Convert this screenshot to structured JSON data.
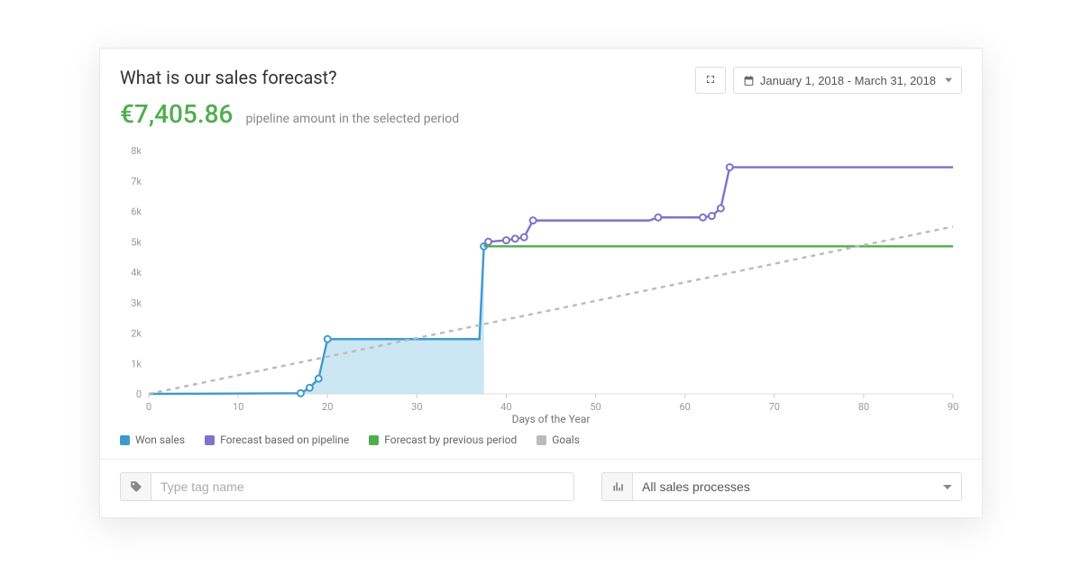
{
  "header": {
    "title": "What is our sales forecast?",
    "metric_value": "€7,405.86",
    "metric_label": "pipeline amount in the selected period",
    "date_range": "January 1, 2018 - March 31, 2018"
  },
  "chart_data": {
    "type": "line",
    "xlabel": "Days of the Year",
    "ylabel": "",
    "xlim": [
      0,
      90
    ],
    "ylim": [
      0,
      8000
    ],
    "x_ticks": [
      0,
      10,
      20,
      30,
      40,
      50,
      60,
      70,
      80,
      90
    ],
    "y_ticks": [
      0,
      1000,
      2000,
      3000,
      4000,
      5000,
      6000,
      7000,
      8000
    ],
    "y_tick_labels": [
      "0",
      "1k",
      "2k",
      "3k",
      "4k",
      "5k",
      "6k",
      "7k",
      "8k"
    ],
    "colors": {
      "won": "#3d9ad1",
      "won_fill": "#b6dcef",
      "forecast_pipeline": "#7f72c9",
      "forecast_previous": "#4fae4e",
      "goals": "#bbbbbb"
    },
    "series": [
      {
        "name": "Won sales",
        "x": [
          0,
          17,
          18,
          19,
          20,
          37,
          37.5
        ],
        "values": [
          0,
          20,
          200,
          500,
          1800,
          1800,
          4850
        ],
        "fill": true,
        "markers_x": [
          17,
          18,
          19,
          20,
          37.5
        ],
        "markers_y": [
          20,
          200,
          500,
          1800,
          4850
        ]
      },
      {
        "name": "Forecast based on pipeline",
        "x": [
          37.5,
          38,
          40,
          41,
          42,
          43,
          44,
          56,
          57,
          62,
          63,
          64,
          65,
          90
        ],
        "values": [
          4850,
          5000,
          5050,
          5100,
          5150,
          5700,
          5700,
          5700,
          5800,
          5800,
          5850,
          6100,
          7450,
          7450
        ],
        "markers_x": [
          38,
          40,
          41,
          42,
          43,
          57,
          62,
          63,
          64,
          65
        ],
        "markers_y": [
          5000,
          5050,
          5100,
          5150,
          5700,
          5800,
          5800,
          5850,
          6100,
          7450
        ]
      },
      {
        "name": "Forecast by previous period",
        "x": [
          37.5,
          90
        ],
        "values": [
          4850,
          4850
        ]
      },
      {
        "name": "Goals",
        "x": [
          0,
          90
        ],
        "values": [
          0,
          5500
        ],
        "dashed": true
      }
    ],
    "legend": [
      "Won sales",
      "Forecast based on pipeline",
      "Forecast by previous period",
      "Goals"
    ]
  },
  "footer": {
    "tag_placeholder": "Type tag name",
    "process_selected": "All sales processes"
  }
}
